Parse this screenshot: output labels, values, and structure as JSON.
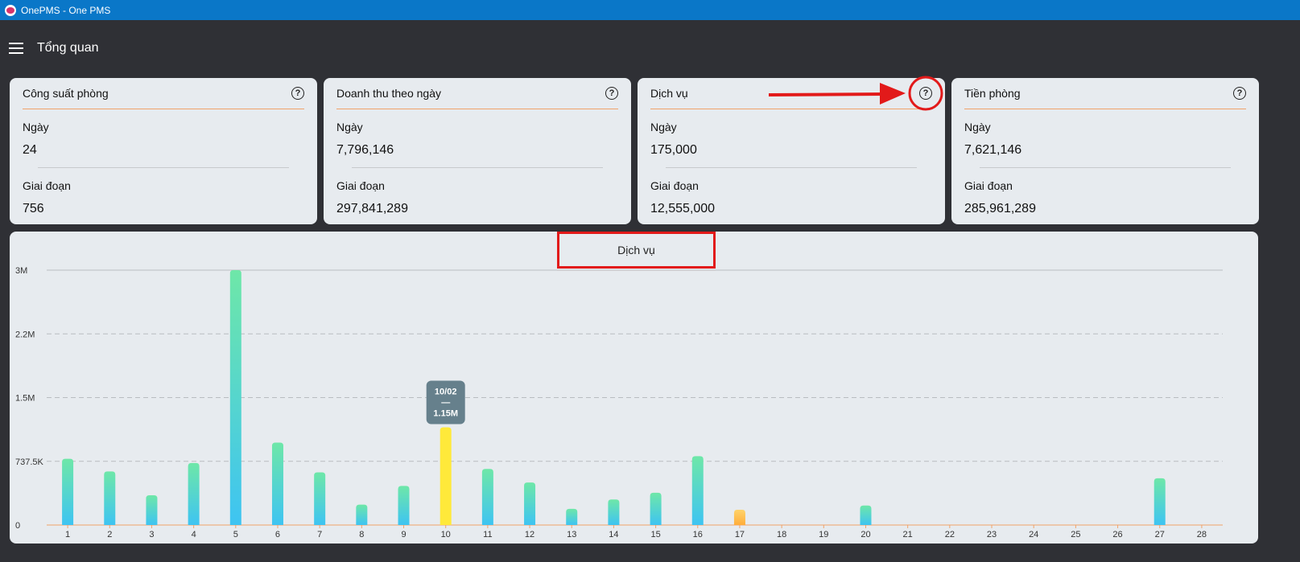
{
  "window": {
    "title": "OnePMS - One PMS"
  },
  "appbar": {
    "title": "Tổng quan"
  },
  "cards": [
    {
      "title": "Công suất phòng",
      "day_label": "Ngày",
      "day_value": "24",
      "period_label": "Giai đoạn",
      "period_value": "756"
    },
    {
      "title": "Doanh thu theo ngày",
      "day_label": "Ngày",
      "day_value": "7,796,146",
      "period_label": "Giai đoạn",
      "period_value": "297,841,289"
    },
    {
      "title": "Dịch vụ",
      "day_label": "Ngày",
      "day_value": "175,000",
      "period_label": "Giai đoạn",
      "period_value": "12,555,000"
    },
    {
      "title": "Tiền phòng",
      "day_label": "Ngày",
      "day_value": "7,621,146",
      "period_label": "Giai đoạn",
      "period_value": "285,961,289"
    }
  ],
  "help_icon_glyph": "?",
  "chart_data": {
    "type": "bar",
    "title": "Dịch vụ",
    "categories": [
      "1",
      "2",
      "3",
      "4",
      "5",
      "6",
      "7",
      "8",
      "9",
      "10",
      "11",
      "12",
      "13",
      "14",
      "15",
      "16",
      "17",
      "18",
      "19",
      "20",
      "21",
      "22",
      "23",
      "24",
      "25",
      "26",
      "27",
      "28"
    ],
    "values": [
      780000,
      630000,
      350000,
      730000,
      3000000,
      970000,
      620000,
      240000,
      460000,
      1150000,
      660000,
      500000,
      190000,
      300000,
      380000,
      810000,
      180000,
      0,
      0,
      230000,
      0,
      0,
      0,
      0,
      0,
      0,
      550000,
      0
    ],
    "ylim": [
      0,
      3000000
    ],
    "yticks": [
      "0",
      "737.5K",
      "1.5M",
      "2.2M",
      "3M"
    ],
    "highlight_index": 9,
    "today_index": 16,
    "tooltip": {
      "date": "10/02",
      "separator": "—",
      "value": "1.15M"
    },
    "colors": {
      "bar_top": "#6ee7a8",
      "bar_bottom": "#3ec4f2",
      "highlight": "#ffe93a",
      "today_top": "#ffd36a",
      "today_bottom": "#ffad3a",
      "grid": "#b9bcc0",
      "tooltip_bg": "#66808c"
    }
  },
  "annotations": {
    "color": "#e21a1a"
  }
}
